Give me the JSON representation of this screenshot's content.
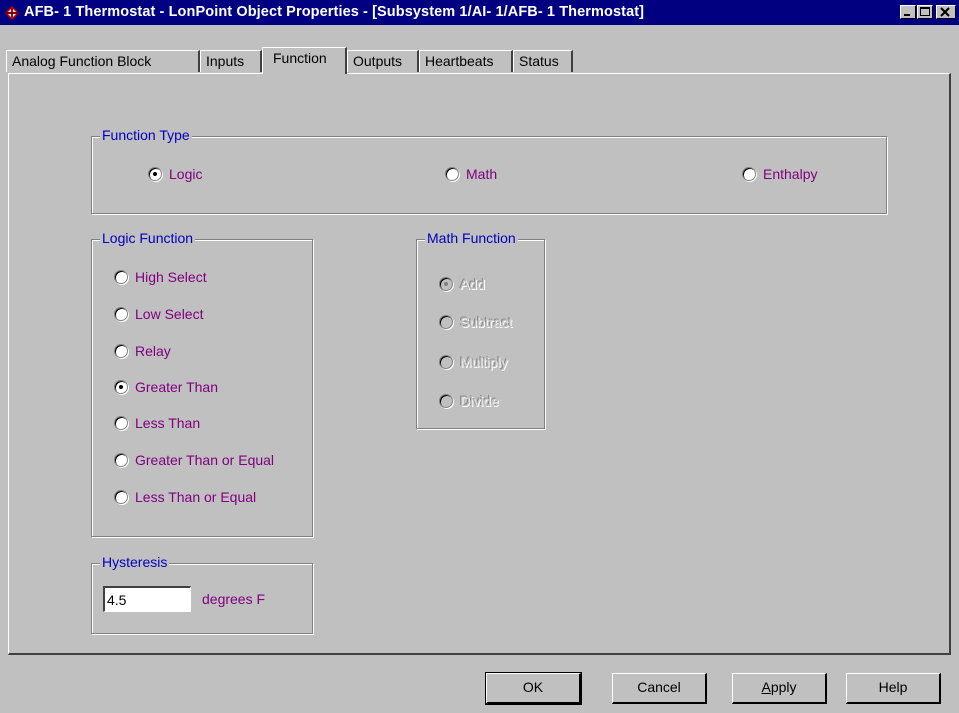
{
  "window": {
    "title": "AFB- 1 Thermostat - LonPoint Object Properties - [Subsystem 1/AI- 1/AFB- 1 Thermostat]"
  },
  "tabs": [
    {
      "label": "Analog Function Block",
      "active": false
    },
    {
      "label": "Inputs",
      "active": false
    },
    {
      "label": "Function",
      "active": true
    },
    {
      "label": "Outputs",
      "active": false
    },
    {
      "label": "Heartbeats",
      "active": false
    },
    {
      "label": "Status",
      "active": false
    }
  ],
  "function_type": {
    "legend": "Function Type",
    "options": [
      {
        "label": "Logic",
        "selected": true
      },
      {
        "label": "Math",
        "selected": false
      },
      {
        "label": "Enthalpy",
        "selected": false
      }
    ]
  },
  "logic_function": {
    "legend": "Logic Function",
    "options": [
      {
        "label": "High Select",
        "selected": false
      },
      {
        "label": "Low Select",
        "selected": false
      },
      {
        "label": "Relay",
        "selected": false
      },
      {
        "label": "Greater Than",
        "selected": true
      },
      {
        "label": "Less Than",
        "selected": false
      },
      {
        "label": "Greater Than or Equal",
        "selected": false
      },
      {
        "label": "Less Than or Equal",
        "selected": false
      }
    ]
  },
  "math_function": {
    "legend": "Math Function",
    "disabled": true,
    "options": [
      {
        "label": "Add",
        "selected": true
      },
      {
        "label": "Subtract",
        "selected": false
      },
      {
        "label": "Multiply",
        "selected": false
      },
      {
        "label": "Divide",
        "selected": false
      }
    ]
  },
  "hysteresis": {
    "legend": "Hysteresis",
    "value": "4.5",
    "units": "degrees F"
  },
  "buttons": {
    "ok": "OK",
    "cancel": "Cancel",
    "apply": "Apply",
    "help": "Help"
  }
}
